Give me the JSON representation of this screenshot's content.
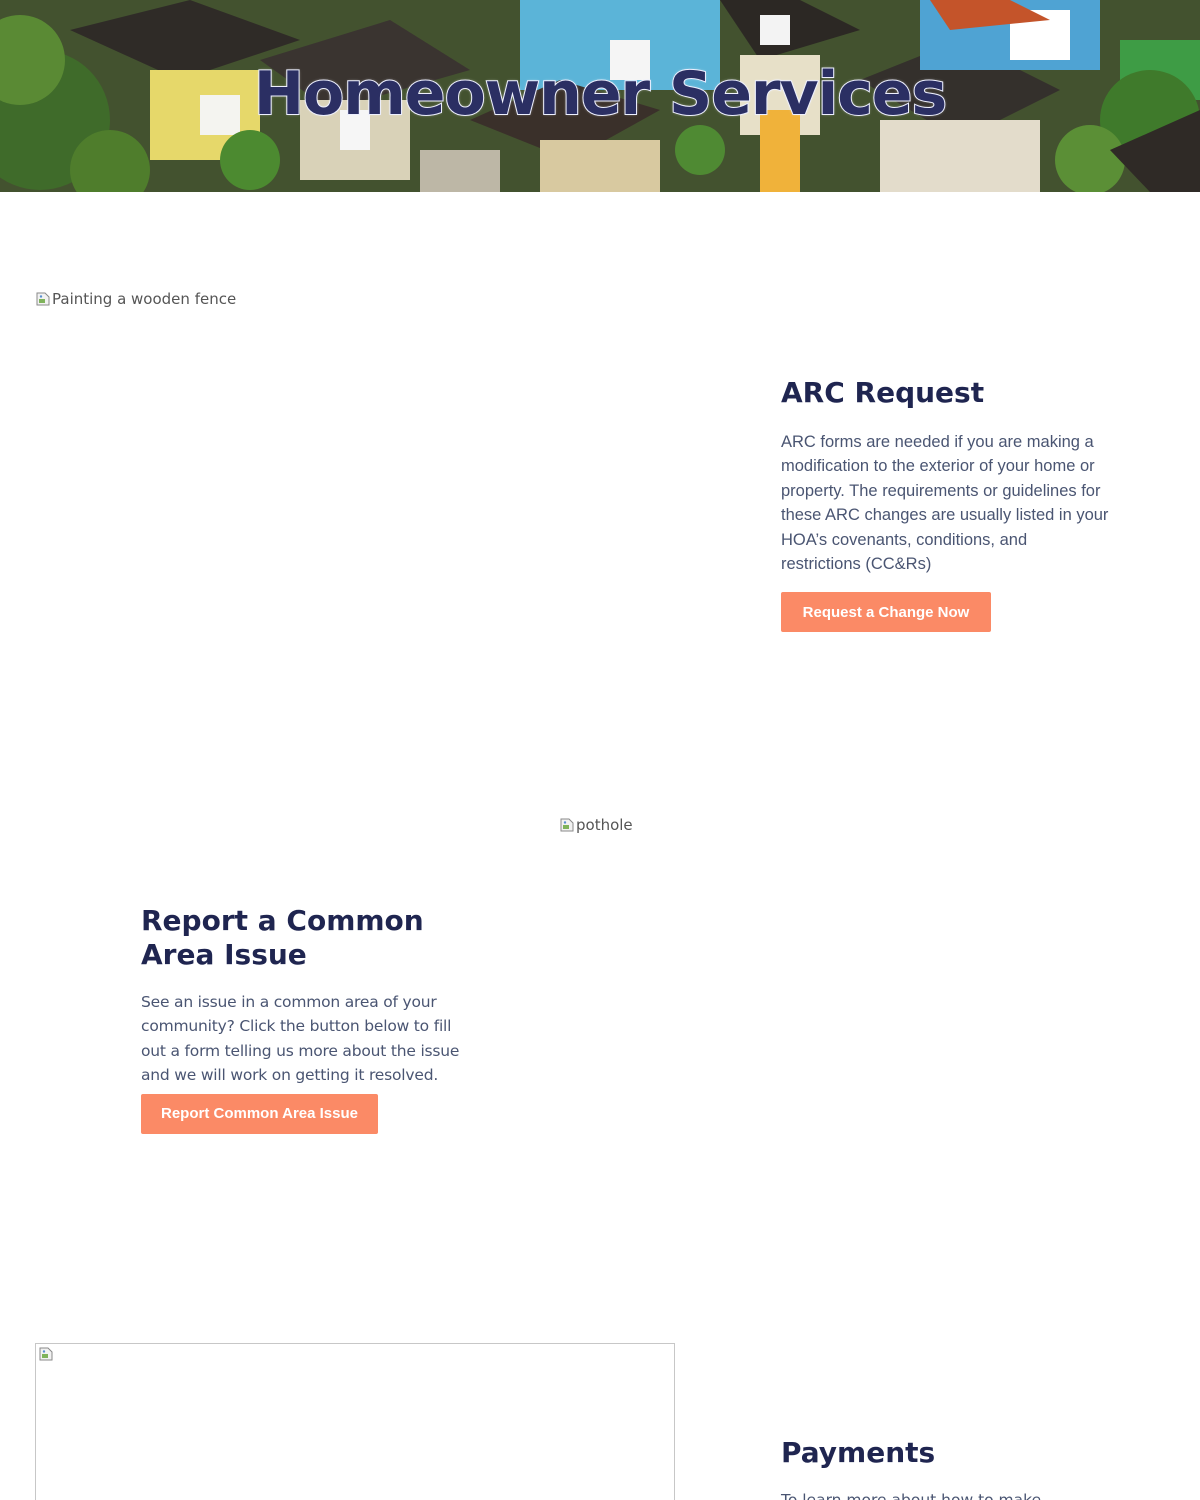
{
  "hero": {
    "title": "Homeowner Services",
    "title_color": "#2b2f63"
  },
  "images": {
    "fence_alt": "Painting a wooden fence",
    "pothole_alt": "pothole",
    "payments_alt": ""
  },
  "arc": {
    "heading": "ARC Request",
    "body": "ARC forms are needed if you are making a modification to the exterior of your home or property. The requirements or guidelines for these ARC changes are usually listed in your HOA’s covenants, conditions, and restrictions (CC&Rs)",
    "button_label": "Request a Change Now"
  },
  "report": {
    "heading": "Report a Common Area Issue",
    "body": "See an issue in a common area of your community? Click the button below to fill out a form telling us more about the issue and we will work on getting it resolved.",
    "button_label": "Report Common Area Issue"
  },
  "payments": {
    "heading": "Payments",
    "body": "To learn more about how to make"
  },
  "colors": {
    "accent_button": "#fb8a66",
    "heading": "#1f2550",
    "body_text": "#4a5572"
  }
}
